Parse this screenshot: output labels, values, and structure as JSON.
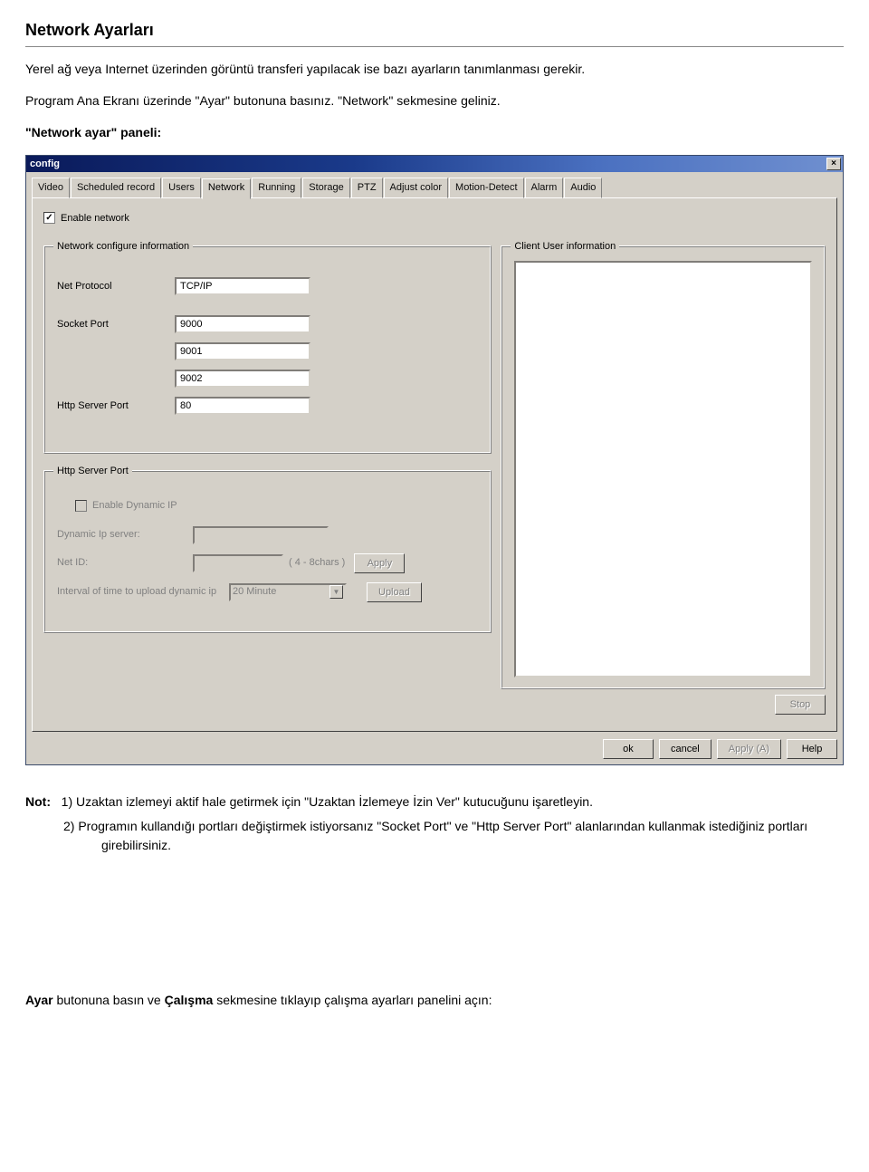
{
  "doc": {
    "title": "Network Ayarları",
    "intro": "Yerel ağ veya Internet üzerinden görüntü transferi yapılacak ise bazı ayarların tanımlanması gerekir.",
    "steps": "Program Ana Ekranı üzerinde \"Ayar\" butonuna basınız. \"Network\" sekmesine geliniz.",
    "panel_label": "\"Network ayar\" paneli:",
    "notes_label": "Not:",
    "note1": "1) Uzaktan izlemeyi aktif hale getirmek için \"Uzaktan İzlemeye İzin Ver\" kutucuğunu işaretleyin.",
    "note2": "2) Programın kullandığı portları değiştirmek istiyorsanız \"Socket Port\" ve \"Http Server Port\" alanlarından kullanmak istediğiniz portları girebilirsiniz.",
    "ayar_line_prefix": "Ayar",
    "ayar_line_mid": " butonuna basın ve ",
    "ayar_line_calisma": "Çalışma",
    "ayar_line_suffix": " sekmesine tıklayıp çalışma ayarları panelini açın:"
  },
  "window": {
    "title": "config",
    "tabs": {
      "video": "Video",
      "scheduled": "Scheduled record",
      "users": "Users",
      "network": "Network",
      "running": "Running",
      "storage": "Storage",
      "ptz": "PTZ",
      "adjust": "Adjust color",
      "motion": "Motion-Detect",
      "alarm": "Alarm",
      "audio": "Audio"
    },
    "enable_network_label": "Enable network",
    "netconf": {
      "legend": "Network configure information",
      "net_protocol_label": "Net Protocol",
      "net_protocol_value": "TCP/IP",
      "socket_port_label": "Socket Port",
      "socket_port_value": "9000",
      "port2_value": "9001",
      "port3_value": "9002",
      "http_port_label": "Http Server Port",
      "http_port_value": "80"
    },
    "httpserv": {
      "legend": "Http Server Port",
      "enable_dynip_label": "Enable Dynamic IP",
      "dynip_server_label": "Dynamic Ip server:",
      "dynip_server_value": "",
      "netid_label": "Net ID:",
      "netid_value": "",
      "netid_hint": "( 4 - 8chars )",
      "apply_label": "Apply",
      "interval_label": "Interval of time to upload dynamic ip",
      "interval_value": "20 Minute",
      "upload_label": "Upload"
    },
    "client": {
      "legend": "Client User information",
      "stop_label": "Stop"
    },
    "buttons": {
      "ok": "ok",
      "cancel": "cancel",
      "apply": "Apply (A)",
      "help": "Help"
    }
  }
}
